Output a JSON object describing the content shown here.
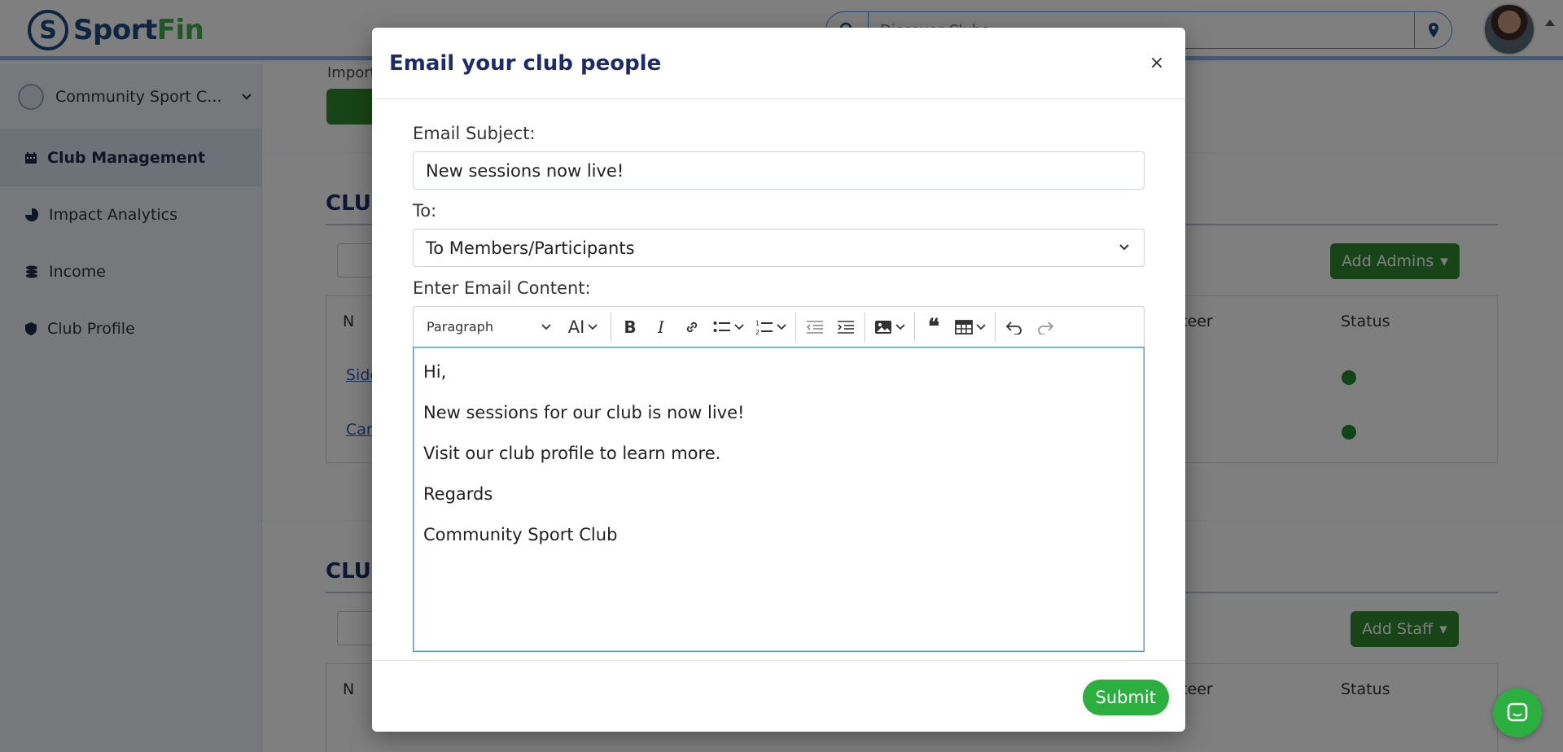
{
  "brand": {
    "part1": "Sport",
    "part2": "Fin",
    "logo_letter": "S"
  },
  "header": {
    "search_placeholder": "Discover Clubs",
    "icons": {
      "search": "search-icon",
      "location": "map-pin-icon",
      "avatar": "user-avatar"
    }
  },
  "sidebar": {
    "club_name": "Community Sport C...",
    "items": [
      {
        "label": "Club Management",
        "icon": "calendar-icon",
        "active": true
      },
      {
        "label": "Impact Analytics",
        "icon": "pie-chart-icon",
        "active": false
      },
      {
        "label": "Income",
        "icon": "coins-icon",
        "active": false
      },
      {
        "label": "Club Profile",
        "icon": "shield-icon",
        "active": false
      }
    ]
  },
  "background": {
    "import_label": "Import",
    "section1_title": "CLUB",
    "section2_title": "CLUB",
    "add_admins": "Add Admins",
    "add_staff": "Add Staff",
    "col_volunteer": "unteer",
    "col_status": "Status",
    "col_name": "N",
    "row1": "Sido",
    "row2": "Can"
  },
  "modal": {
    "title": "Email your club people",
    "close": "×",
    "subject_label": "Email Subject:",
    "subject_value": "New sessions now live!",
    "to_label": "To:",
    "to_value": "To Members/Participants",
    "content_label": "Enter Email Content:",
    "toolbar": {
      "paragraph": "Paragraph",
      "font_size": "AI"
    },
    "content_lines": [
      "Hi,",
      "New sessions for our club is now live!",
      "Visit our club profile to learn more.",
      "Regards",
      "Community Sport Club"
    ],
    "submit": "Submit"
  },
  "colors": {
    "brand_blue": "#1a4b7c",
    "brand_green": "#3db34a",
    "title_navy": "#1d2b6b",
    "button_green": "#2bb03f",
    "dark_green": "#2e8b2e"
  }
}
